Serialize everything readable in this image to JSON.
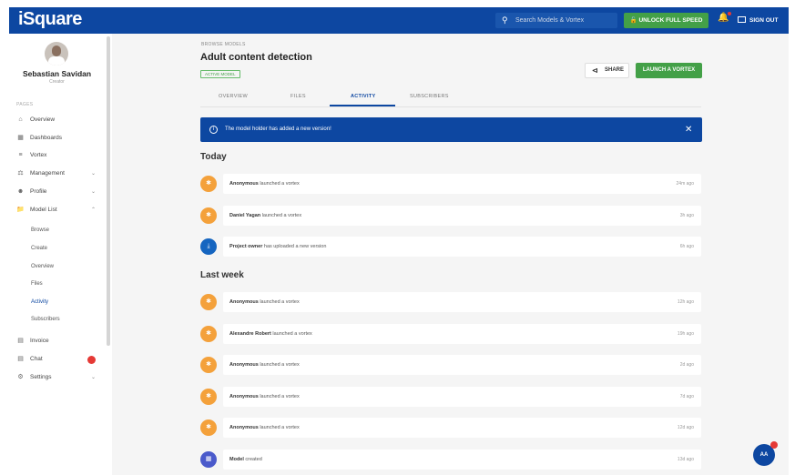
{
  "app": {
    "logo": "iSquare"
  },
  "header": {
    "search_placeholder": "Search Models & Vortex",
    "unlock_label": "UNLOCK FULL SPEED",
    "signout_label": "SIGN OUT"
  },
  "sidebar": {
    "user_name": "Sebastian Savidan",
    "user_role": "Creator",
    "pages_label": "PAGES",
    "items": [
      {
        "label": "Overview",
        "icon": "home-icon"
      },
      {
        "label": "Dashboards",
        "icon": "dashboard-icon"
      },
      {
        "label": "Vortex",
        "icon": "vortex-icon"
      },
      {
        "label": "Management",
        "icon": "management-icon"
      },
      {
        "label": "Profile",
        "icon": "profile-icon"
      },
      {
        "label": "Model List",
        "icon": "folder-icon"
      }
    ],
    "sub_items": [
      "Browse",
      "Create",
      "Overview",
      "Files",
      "Activity",
      "Subscribers"
    ],
    "items_bottom": [
      {
        "label": "Invoice",
        "icon": "invoice-icon"
      },
      {
        "label": "Chat",
        "icon": "chat-icon"
      },
      {
        "label": "Settings",
        "icon": "settings-icon"
      }
    ]
  },
  "main": {
    "breadcrumb": "BROWSE MODELS",
    "title": "Adult content detection",
    "status_badge": "ACTIVE MODEL",
    "share_label": "SHARE",
    "launch_label": "LAUNCH A VORTEX",
    "tabs": [
      "OVERVIEW",
      "FILES",
      "ACTIVITY",
      "SUBSCRIBERS"
    ],
    "active_tab": "ACTIVITY",
    "alert_text": "The model holder has added a new version!",
    "sections": [
      {
        "title": "Today",
        "items": [
          {
            "who": "Anonymous",
            "action": "launched a vortex",
            "time": "24m ago",
            "icon": "vortex-launch-icon"
          },
          {
            "who": "Daniel Yagan",
            "action": "launched a vortex",
            "time": "3h ago",
            "icon": "vortex-launch-icon"
          },
          {
            "who": "Project owner",
            "action": "has uploaded a new version",
            "time": "6h ago",
            "icon": "download-icon"
          }
        ]
      },
      {
        "title": "Last week",
        "items": [
          {
            "who": "Anonymous",
            "action": "launched a vortex",
            "time": "12h ago",
            "icon": "vortex-launch-icon"
          },
          {
            "who": "Alexandre Robert",
            "action": "launched a vortex",
            "time": "19h ago",
            "icon": "vortex-launch-icon"
          },
          {
            "who": "Anonymous",
            "action": "launched a vortex",
            "time": "2d ago",
            "icon": "vortex-launch-icon"
          },
          {
            "who": "Anonymous",
            "action": "launched a vortex",
            "time": "7d ago",
            "icon": "vortex-launch-icon"
          },
          {
            "who": "Anonymous",
            "action": "launched a vortex",
            "time": "12d ago",
            "icon": "vortex-launch-icon"
          },
          {
            "who": "Model",
            "action": "created",
            "time": "13d ago",
            "icon": "model-icon"
          }
        ]
      }
    ]
  },
  "fab": {
    "label": "AA"
  },
  "colors": {
    "primary": "#0d47a1",
    "accent": "#43a047",
    "orange": "#f4a13b",
    "badge": "#e53935"
  }
}
